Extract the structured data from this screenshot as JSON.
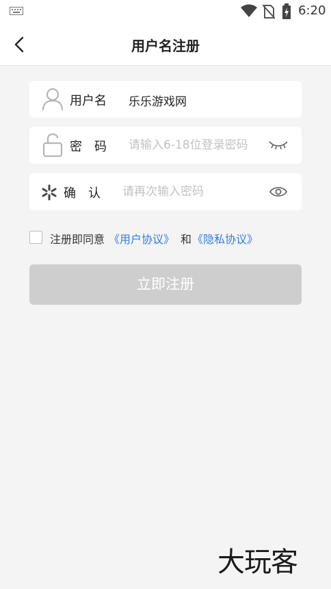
{
  "status_bar": {
    "time": "6:20"
  },
  "nav": {
    "title": "用户名注册"
  },
  "username": {
    "label": "用户名",
    "value": "乐乐游戏网"
  },
  "password": {
    "label": "密　码",
    "placeholder": "请输入6-18位登录密码"
  },
  "confirm": {
    "label": "确　认",
    "placeholder": "请再次输入密码"
  },
  "agreement": {
    "prefix": "注册即同意",
    "user_agreement": "《用户协议》",
    "and": "和",
    "privacy_agreement": "《隐私协议》"
  },
  "submit": {
    "label": "立即注册"
  },
  "watermark": {
    "text": "大玩客"
  },
  "colors": {
    "link": "#2f7fe0",
    "button_disabled": "#cecece",
    "background": "#f4f4f4"
  }
}
